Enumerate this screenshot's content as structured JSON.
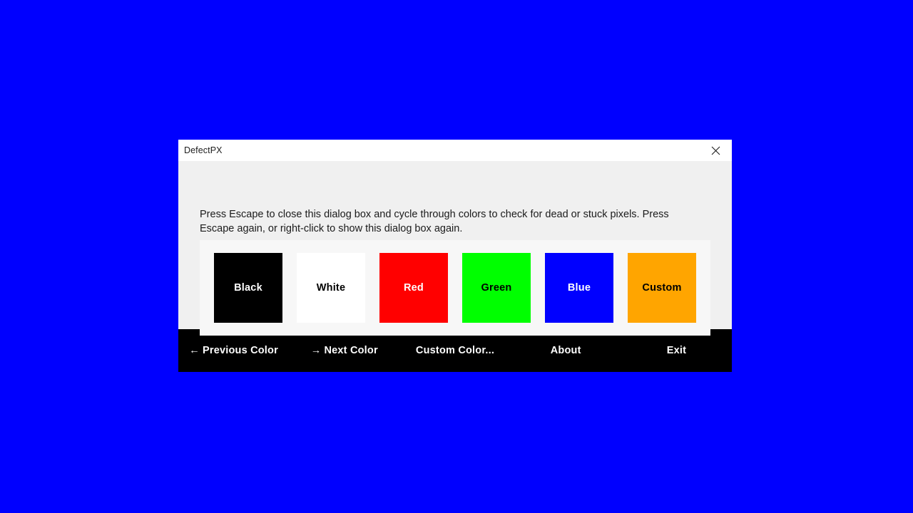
{
  "desktop": {
    "background_color": "#0000FF"
  },
  "dialog": {
    "title": "DefectPX",
    "close_icon": "close-icon",
    "instructions": "Press Escape to close this dialog box and cycle through colors to check for dead or stuck pixels. Press Escape again, or right-click to show this dialog box again.",
    "swatches": [
      {
        "label": "Black",
        "color": "#000000",
        "text_color": "#FFFFFF"
      },
      {
        "label": "White",
        "color": "#FFFFFF",
        "text_color": "#000000"
      },
      {
        "label": "Red",
        "color": "#FF0000",
        "text_color": "#FFFFFF"
      },
      {
        "label": "Green",
        "color": "#00FF00",
        "text_color": "#000000"
      },
      {
        "label": "Blue",
        "color": "#0000FF",
        "text_color": "#FFFFFF"
      },
      {
        "label": "Custom",
        "color": "#FFA500",
        "text_color": "#000000"
      }
    ],
    "toolbar": [
      {
        "arrow": "←",
        "label": "Previous Color"
      },
      {
        "arrow": "→",
        "label": "Next Color"
      },
      {
        "arrow": "",
        "label": "Custom Color..."
      },
      {
        "arrow": "",
        "label": "About"
      },
      {
        "arrow": "",
        "label": "Exit"
      }
    ]
  }
}
